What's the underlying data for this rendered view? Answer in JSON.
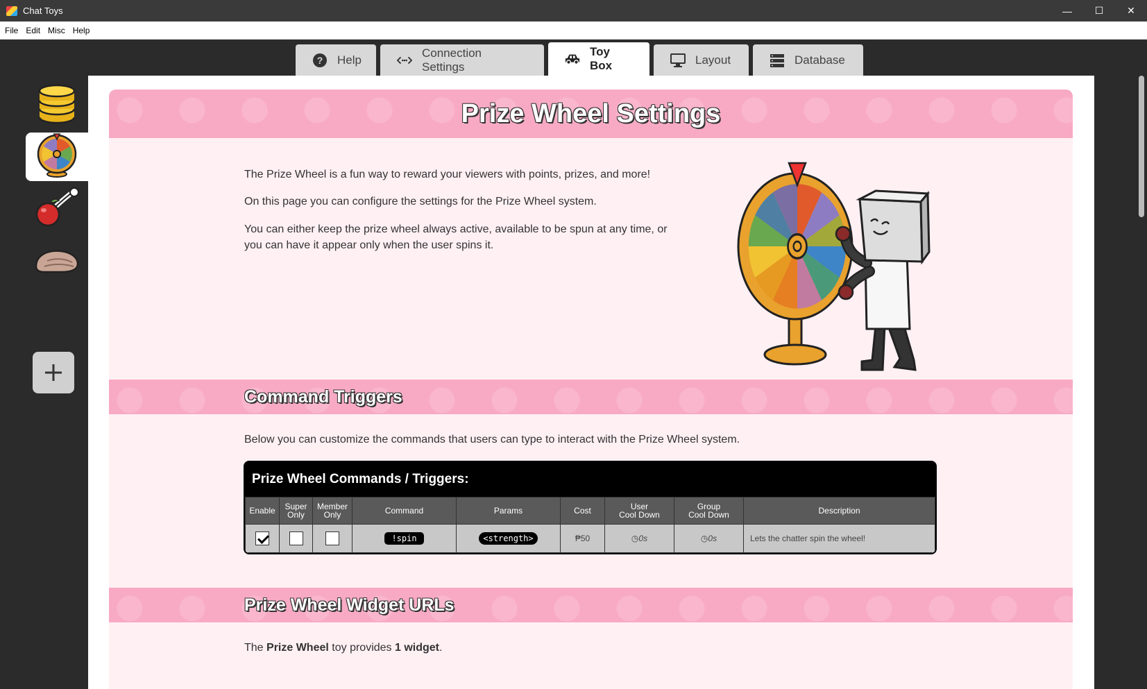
{
  "window": {
    "title": "Chat Toys",
    "controls": {
      "minimize": "—",
      "maximize": "☐",
      "close": "✕"
    }
  },
  "menu": [
    "File",
    "Edit",
    "Misc",
    "Help"
  ],
  "tabs": [
    {
      "label": "Help",
      "icon": "question-circle-icon"
    },
    {
      "label": "Connection Settings",
      "icon": "connection-icon"
    },
    {
      "label": "Toy Box",
      "icon": "toy-car-icon",
      "active": true
    },
    {
      "label": "Layout",
      "icon": "monitor-icon"
    },
    {
      "label": "Database",
      "icon": "database-icon"
    }
  ],
  "sidebar": {
    "items": [
      {
        "icon": "coin-stack-icon"
      },
      {
        "icon": "prize-wheel-icon",
        "active": true
      },
      {
        "icon": "cherry-bomb-icon"
      },
      {
        "icon": "hand-icon"
      }
    ],
    "add_label": "+"
  },
  "page": {
    "title": "Prize Wheel Settings",
    "intro": [
      "The Prize Wheel is a fun way to reward your viewers with points, prizes, and more!",
      "On this page you can configure the settings for the Prize Wheel system.",
      "You can either keep the prize wheel always active, available to be spun at any time, or you can have it appear only when the user spins it."
    ],
    "commands_section": {
      "title": "Command Triggers",
      "description": "Below you can customize the commands that users can type to interact with the Prize Wheel system.",
      "table_title": "Prize Wheel Commands / Triggers:",
      "headers": {
        "enable": "Enable",
        "super_1": "Super",
        "super_2": "Only",
        "member_1": "Member",
        "member_2": "Only",
        "command": "Command",
        "params": "Params",
        "cost": "Cost",
        "user_cd_1": "User",
        "user_cd_2": "Cool Down",
        "group_cd_1": "Group",
        "group_cd_2": "Cool Down",
        "description": "Description"
      },
      "rows": [
        {
          "enabled": true,
          "super_only": false,
          "member_only": false,
          "command": "!spin",
          "params": "<strength>",
          "cost": "₱50",
          "user_cooldown": "0s",
          "group_cooldown": "0s",
          "description": "Lets the chatter spin the wheel!"
        }
      ]
    },
    "widgets_section": {
      "title": "Prize Wheel Widget URLs",
      "text_pre": "The ",
      "text_bold1": "Prize Wheel",
      "text_mid": " toy provides ",
      "text_bold2": "1 widget",
      "text_post": "."
    }
  }
}
